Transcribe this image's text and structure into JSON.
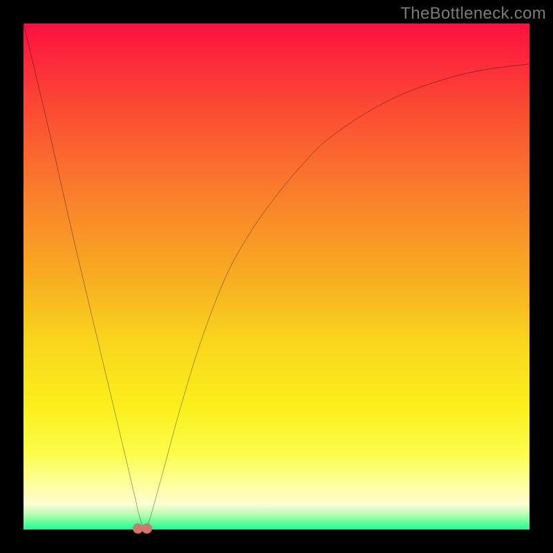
{
  "watermark": "TheBottleneck.com",
  "colors": {
    "frame": "#000000",
    "curve": "#000000",
    "dot": "#d2756f",
    "gradient_top": "#fd1041",
    "gradient_bottom": "#18ff97"
  },
  "chart_data": {
    "type": "line",
    "title": "",
    "xlabel": "",
    "ylabel": "",
    "xlim": [
      0,
      100
    ],
    "ylim": [
      0,
      100
    ],
    "grid": false,
    "legend": false,
    "series": [
      {
        "name": "bottleneck-curve",
        "x": [
          0,
          5,
          10,
          15,
          20,
          22,
          23,
          24,
          25,
          28,
          31,
          35,
          40,
          45,
          50,
          55,
          60,
          68,
          76,
          85,
          92,
          100
        ],
        "values": [
          100,
          79,
          57,
          36,
          15,
          6.5,
          2.3,
          0.2,
          2.2,
          13,
          24,
          37,
          50,
          59,
          66,
          72,
          77,
          82.5,
          86.5,
          89.5,
          91,
          92
        ]
      }
    ],
    "markers": [
      {
        "name": "min-dot-left",
        "x": 22.6,
        "y": 0.2
      },
      {
        "name": "min-dot-right",
        "x": 24.4,
        "y": 0.2
      }
    ]
  }
}
